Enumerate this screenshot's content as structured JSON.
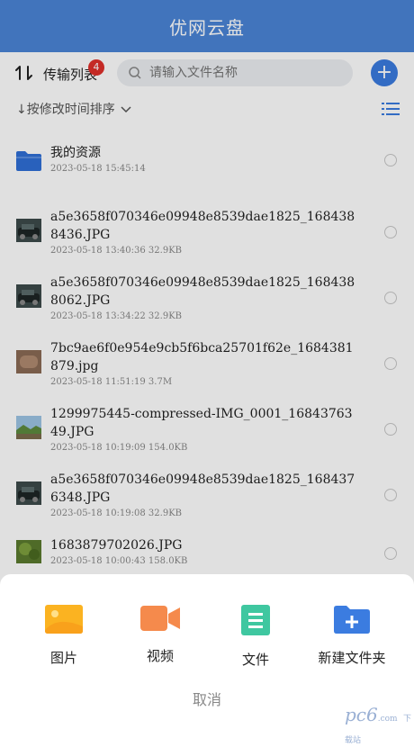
{
  "header": {
    "title": "优网云盘"
  },
  "toolbar": {
    "transfer_label": "传输列表",
    "transfer_badge": "4",
    "search_placeholder": "请输入文件名称"
  },
  "sort": {
    "label": "↓按修改时间排序"
  },
  "files": [
    {
      "type": "folder",
      "name": "我的资源",
      "meta": "2023-05-18 15:45:14"
    },
    {
      "type": "image",
      "thumb": "car",
      "name": "a5e3658f070346e09948e8539dae1825_1684388436.JPG",
      "meta": "2023-05-18 13:40:36  32.9KB"
    },
    {
      "type": "image",
      "thumb": "car",
      "name": "a5e3658f070346e09948e8539dae1825_1684388062.JPG",
      "meta": "2023-05-18 13:34:22  32.9KB"
    },
    {
      "type": "image",
      "thumb": "brown",
      "name": "7bc9ae6f0e954e9cb5f6bca25701f62e_1684381879.jpg",
      "meta": "2023-05-18 11:51:19  3.7M"
    },
    {
      "type": "image",
      "thumb": "landscape",
      "name": "1299975445-compressed-IMG_0001_1684376349.JPG",
      "meta": "2023-05-18 10:19:09  154.0KB"
    },
    {
      "type": "image",
      "thumb": "car",
      "name": "a5e3658f070346e09948e8539dae1825_1684376348.JPG",
      "meta": "2023-05-18 10:19:08  32.9KB"
    },
    {
      "type": "image",
      "thumb": "green",
      "name": "1683879702026.JPG",
      "meta": "2023-05-18 10:00:43  158.0KB"
    }
  ],
  "sheet": {
    "actions": [
      {
        "label": "图片",
        "icon": "image-icon"
      },
      {
        "label": "视频",
        "icon": "video-icon"
      },
      {
        "label": "文件",
        "icon": "document-icon"
      },
      {
        "label": "新建文件夹",
        "icon": "new-folder-icon"
      }
    ],
    "cancel_label": "取消"
  },
  "watermark": {
    "text": "pc6",
    "sub": "下载站",
    "domain": ".com"
  },
  "colors": {
    "header": "#4a85d6",
    "accent": "#3b7ce0",
    "badge": "#e0302b",
    "folder": "#2f6fd6"
  }
}
